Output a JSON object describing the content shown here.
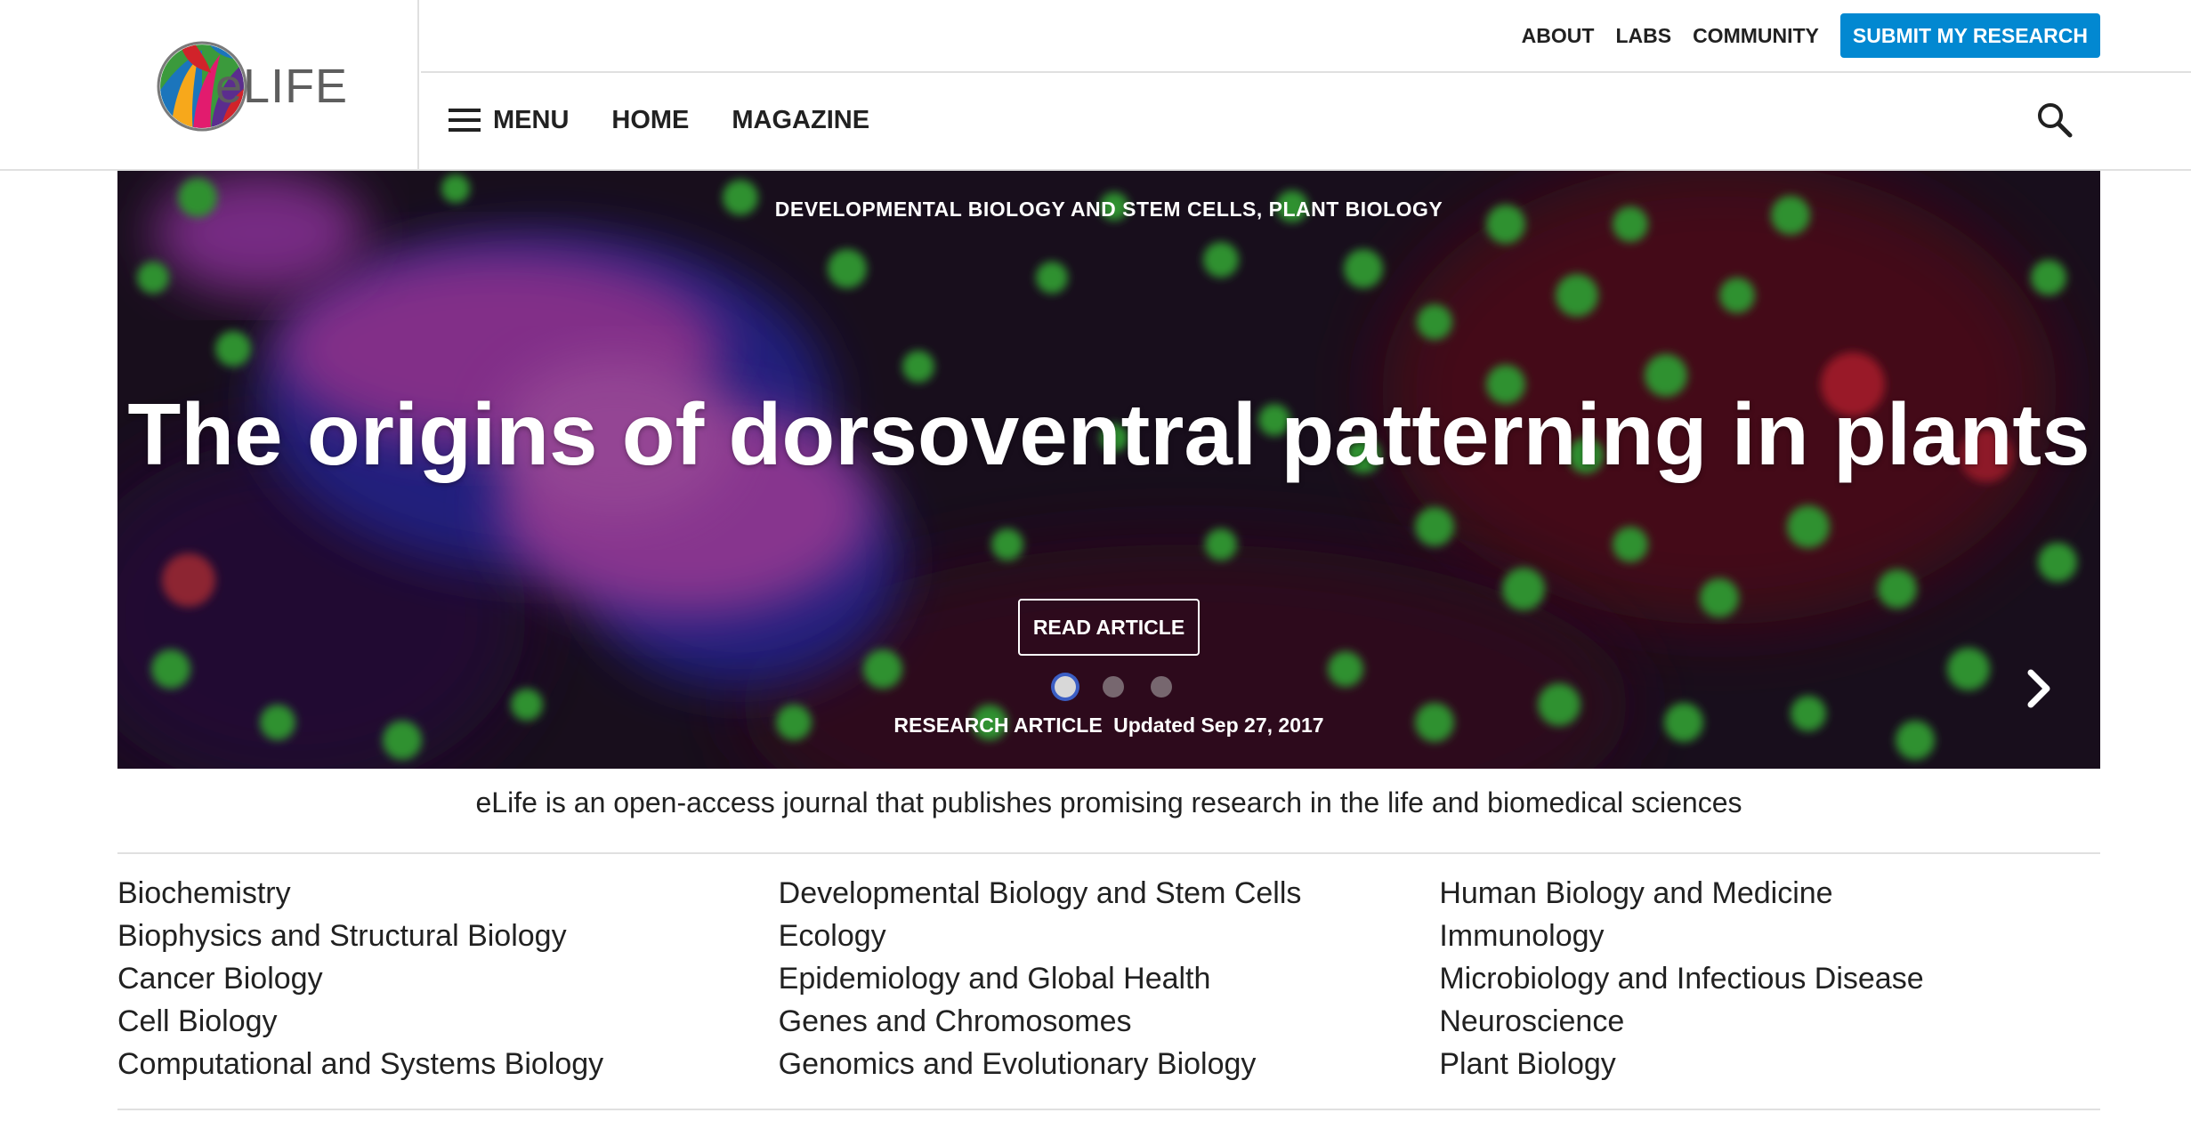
{
  "brand": {
    "name": "eLIFE",
    "logo_colors": [
      "#e21b6e",
      "#f7a81b",
      "#3b9a3c",
      "#1b75bc",
      "#5b2d8e",
      "#d1232a"
    ]
  },
  "header": {
    "top_links": [
      "ABOUT",
      "LABS",
      "COMMUNITY"
    ],
    "submit_label": "SUBMIT MY RESEARCH",
    "accent_color": "#0288d1",
    "nav": {
      "menu_label": "MENU",
      "home_label": "HOME",
      "magazine_label": "MAGAZINE"
    },
    "search_icon": "search-icon"
  },
  "hero": {
    "subjects": "DEVELOPMENTAL BIOLOGY AND STEM CELLS, PLANT BIOLOGY",
    "title": "The origins of dorsoventral patterning in plants",
    "read_label": "READ ARTICLE",
    "article_type": "RESEARCH ARTICLE",
    "date": "Updated Sep 27, 2017",
    "carousel": {
      "total": 3,
      "active": 1
    }
  },
  "intro": "eLife is an open-access journal that publishes promising research in the life and biomedical sciences",
  "subjects": {
    "col1": [
      "Biochemistry",
      "Biophysics and Structural Biology",
      "Cancer Biology",
      "Cell Biology",
      "Computational and Systems Biology"
    ],
    "col2": [
      "Developmental Biology and Stem Cells",
      "Ecology",
      "Epidemiology and Global Health",
      "Genes and Chromosomes",
      "Genomics and Evolutionary Biology"
    ],
    "col3": [
      "Human Biology and Medicine",
      "Immunology",
      "Microbiology and Infectious Disease",
      "Neuroscience",
      "Plant Biology"
    ]
  }
}
